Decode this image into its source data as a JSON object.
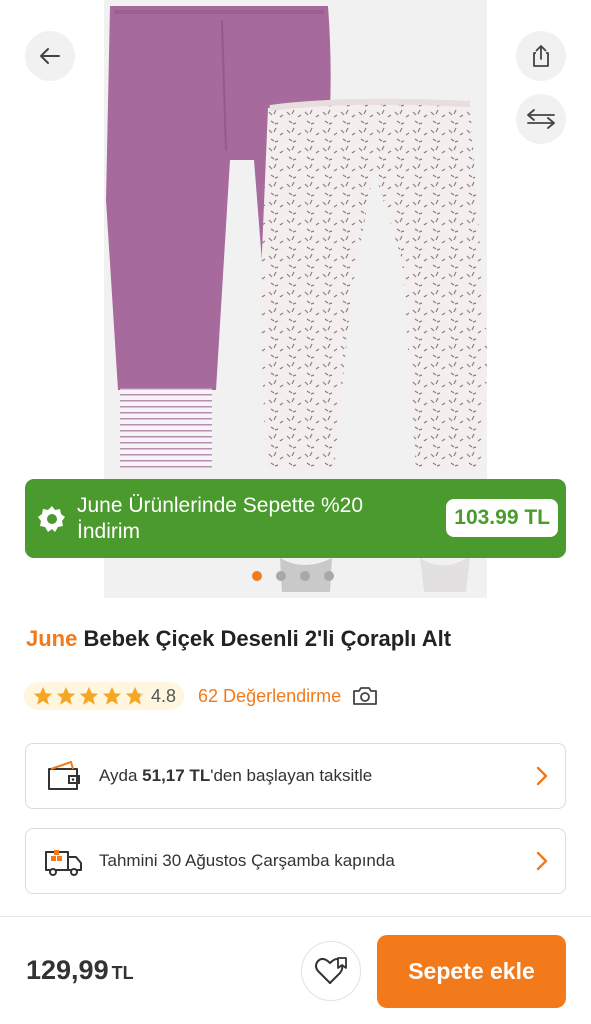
{
  "promo": {
    "text": "June Ürünlerinde Sepette %20 İndirim",
    "price": "103.99 TL"
  },
  "gallery": {
    "image_count": 4,
    "active_index": 0
  },
  "product": {
    "brand": "June",
    "name": "Bebek Çiçek Desenli 2'li Çoraplı Alt"
  },
  "rating": {
    "value": "4.8",
    "stars": 4.8,
    "reviews_label": "62 Değerlendirme"
  },
  "installment": {
    "prefix": "Ayda ",
    "amount": "51,17 TL",
    "suffix": "'den başlayan taksitle"
  },
  "delivery": {
    "text": "Tahmini 30 Ağustos Çarşamba kapında"
  },
  "bottom": {
    "price": "129,99",
    "currency": "TL",
    "cart_label": "Sepete ekle"
  },
  "icons": {
    "back": "arrow-left-icon",
    "share": "share-icon",
    "compare": "compare-arrows-icon",
    "promo": "discount-badge-icon",
    "camera": "camera-icon",
    "wallet": "wallet-icon",
    "truck": "truck-icon",
    "favorite": "heart-icon"
  },
  "colors": {
    "accent": "#f27a1a",
    "promo_green": "#4a9a2d",
    "star": "#f5a623"
  }
}
